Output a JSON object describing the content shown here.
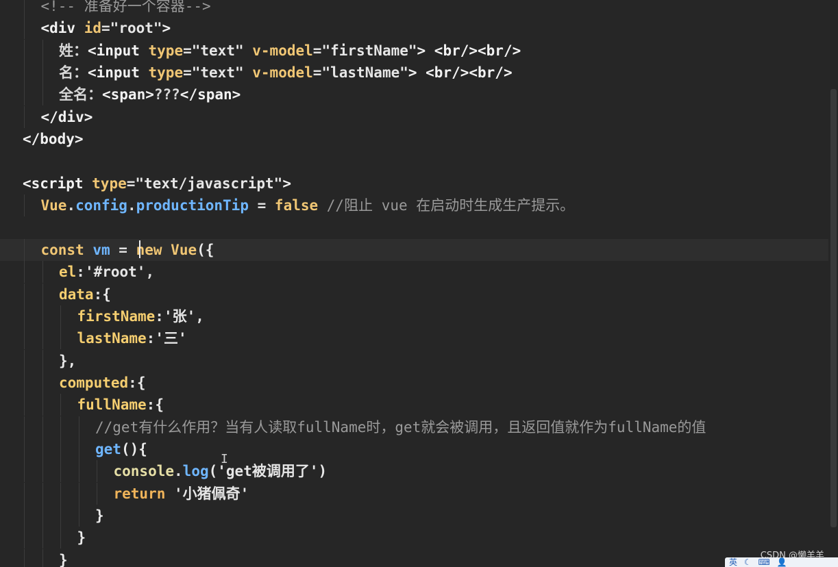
{
  "editor": {
    "lines": [
      {
        "indent": 1,
        "tokens": [
          [
            "t-comment",
            "<!-- 准备好一个容器-->"
          ]
        ]
      },
      {
        "indent": 1,
        "tokens": [
          [
            "t-tag",
            "<div "
          ],
          [
            "t-attr",
            "id"
          ],
          [
            "t-op",
            "="
          ],
          [
            "t-str",
            "\"root\""
          ],
          [
            "t-tag",
            ">"
          ]
        ]
      },
      {
        "indent": 2,
        "tokens": [
          [
            "t-plain",
            "姓："
          ],
          [
            "t-tag",
            "<input "
          ],
          [
            "t-attr",
            "type"
          ],
          [
            "t-op",
            "="
          ],
          [
            "t-str",
            "\"text\" "
          ],
          [
            "t-attr",
            "v-model"
          ],
          [
            "t-op",
            "="
          ],
          [
            "t-str",
            "\"firstName\""
          ],
          [
            "t-tag",
            "> <br/><br/>"
          ]
        ]
      },
      {
        "indent": 2,
        "tokens": [
          [
            "t-plain",
            "名："
          ],
          [
            "t-tag",
            "<input "
          ],
          [
            "t-attr",
            "type"
          ],
          [
            "t-op",
            "="
          ],
          [
            "t-str",
            "\"text\" "
          ],
          [
            "t-attr",
            "v-model"
          ],
          [
            "t-op",
            "="
          ],
          [
            "t-str",
            "\"lastName\""
          ],
          [
            "t-tag",
            "> <br/><br/>"
          ]
        ]
      },
      {
        "indent": 2,
        "tokens": [
          [
            "t-plain",
            "全名："
          ],
          [
            "t-tag",
            "<span>"
          ],
          [
            "t-plain",
            "???"
          ],
          [
            "t-tag",
            "</span>"
          ]
        ]
      },
      {
        "indent": 1,
        "tokens": [
          [
            "t-tag",
            "</div>"
          ]
        ]
      },
      {
        "indent": 0,
        "tokens": [
          [
            "t-tag",
            "</body>"
          ]
        ]
      },
      {
        "indent": 0,
        "tokens": []
      },
      {
        "indent": 0,
        "tokens": [
          [
            "t-tag",
            "<script "
          ],
          [
            "t-attr",
            "type"
          ],
          [
            "t-op",
            "="
          ],
          [
            "t-str",
            "\"text/javascript\""
          ],
          [
            "t-tag",
            ">"
          ]
        ]
      },
      {
        "indent": 1,
        "tokens": [
          [
            "t-obj",
            "Vue"
          ],
          [
            "t-op",
            "."
          ],
          [
            "t-var",
            "config"
          ],
          [
            "t-op",
            "."
          ],
          [
            "t-var",
            "productionTip"
          ],
          [
            "t-op",
            " = "
          ],
          [
            "t-kw",
            "false "
          ],
          [
            "t-comment",
            "//阻止 vue 在启动时生成生产提示。"
          ]
        ]
      },
      {
        "indent": 0,
        "tokens": []
      },
      {
        "indent": 1,
        "tokens": [
          [
            "t-kw",
            "const "
          ],
          [
            "t-var",
            "vm"
          ],
          [
            "t-op",
            " = "
          ],
          [
            "t-kw",
            "new "
          ],
          [
            "t-obj",
            "Vue"
          ],
          [
            "t-brace",
            "({"
          ]
        ],
        "current": true
      },
      {
        "indent": 2,
        "tokens": [
          [
            "t-key",
            "el"
          ],
          [
            "t-op",
            ":"
          ],
          [
            "t-str",
            "'#root'"
          ],
          [
            "t-op",
            ","
          ]
        ]
      },
      {
        "indent": 2,
        "tokens": [
          [
            "t-key",
            "data"
          ],
          [
            "t-op",
            ":"
          ],
          [
            "t-brace",
            "{"
          ]
        ]
      },
      {
        "indent": 3,
        "tokens": [
          [
            "t-key",
            "firstName"
          ],
          [
            "t-op",
            ":"
          ],
          [
            "t-str",
            "'张'"
          ],
          [
            "t-op",
            ","
          ]
        ]
      },
      {
        "indent": 3,
        "tokens": [
          [
            "t-key",
            "lastName"
          ],
          [
            "t-op",
            ":"
          ],
          [
            "t-str",
            "'三'"
          ]
        ]
      },
      {
        "indent": 2,
        "tokens": [
          [
            "t-brace",
            "},"
          ]
        ]
      },
      {
        "indent": 2,
        "tokens": [
          [
            "t-key",
            "computed"
          ],
          [
            "t-op",
            ":"
          ],
          [
            "t-brace",
            "{"
          ]
        ]
      },
      {
        "indent": 3,
        "tokens": [
          [
            "t-key",
            "fullName"
          ],
          [
            "t-op",
            ":"
          ],
          [
            "t-brace",
            "{"
          ]
        ]
      },
      {
        "indent": 4,
        "tokens": [
          [
            "t-comment",
            "//get有什么作用？当有人读取fullName时，get就会被调用，且返回值就作为fullName的值"
          ]
        ]
      },
      {
        "indent": 4,
        "tokens": [
          [
            "t-fn",
            "get"
          ],
          [
            "t-brace",
            "(){"
          ]
        ]
      },
      {
        "indent": 5,
        "tokens": [
          [
            "t-prop",
            "console"
          ],
          [
            "t-op",
            "."
          ],
          [
            "t-fn",
            "log"
          ],
          [
            "t-brace",
            "("
          ],
          [
            "t-str",
            "'get被调用了'"
          ],
          [
            "t-brace",
            ")"
          ]
        ]
      },
      {
        "indent": 5,
        "tokens": [
          [
            "t-ret",
            "return "
          ],
          [
            "t-str",
            "'小猪佩奇'"
          ]
        ]
      },
      {
        "indent": 4,
        "tokens": [
          [
            "t-brace",
            "}"
          ]
        ]
      },
      {
        "indent": 3,
        "tokens": [
          [
            "t-brace",
            "}"
          ]
        ]
      },
      {
        "indent": 2,
        "tokens": [
          [
            "t-brace",
            "}"
          ]
        ]
      }
    ]
  },
  "watermark": "CSDN @懒羊羊",
  "ime": {
    "lang": "英",
    "icons": [
      "moon-icon",
      "keyboard-icon",
      "person-icon"
    ]
  },
  "colors": {
    "background": "#262626",
    "current_line": "#2e2e2e"
  }
}
